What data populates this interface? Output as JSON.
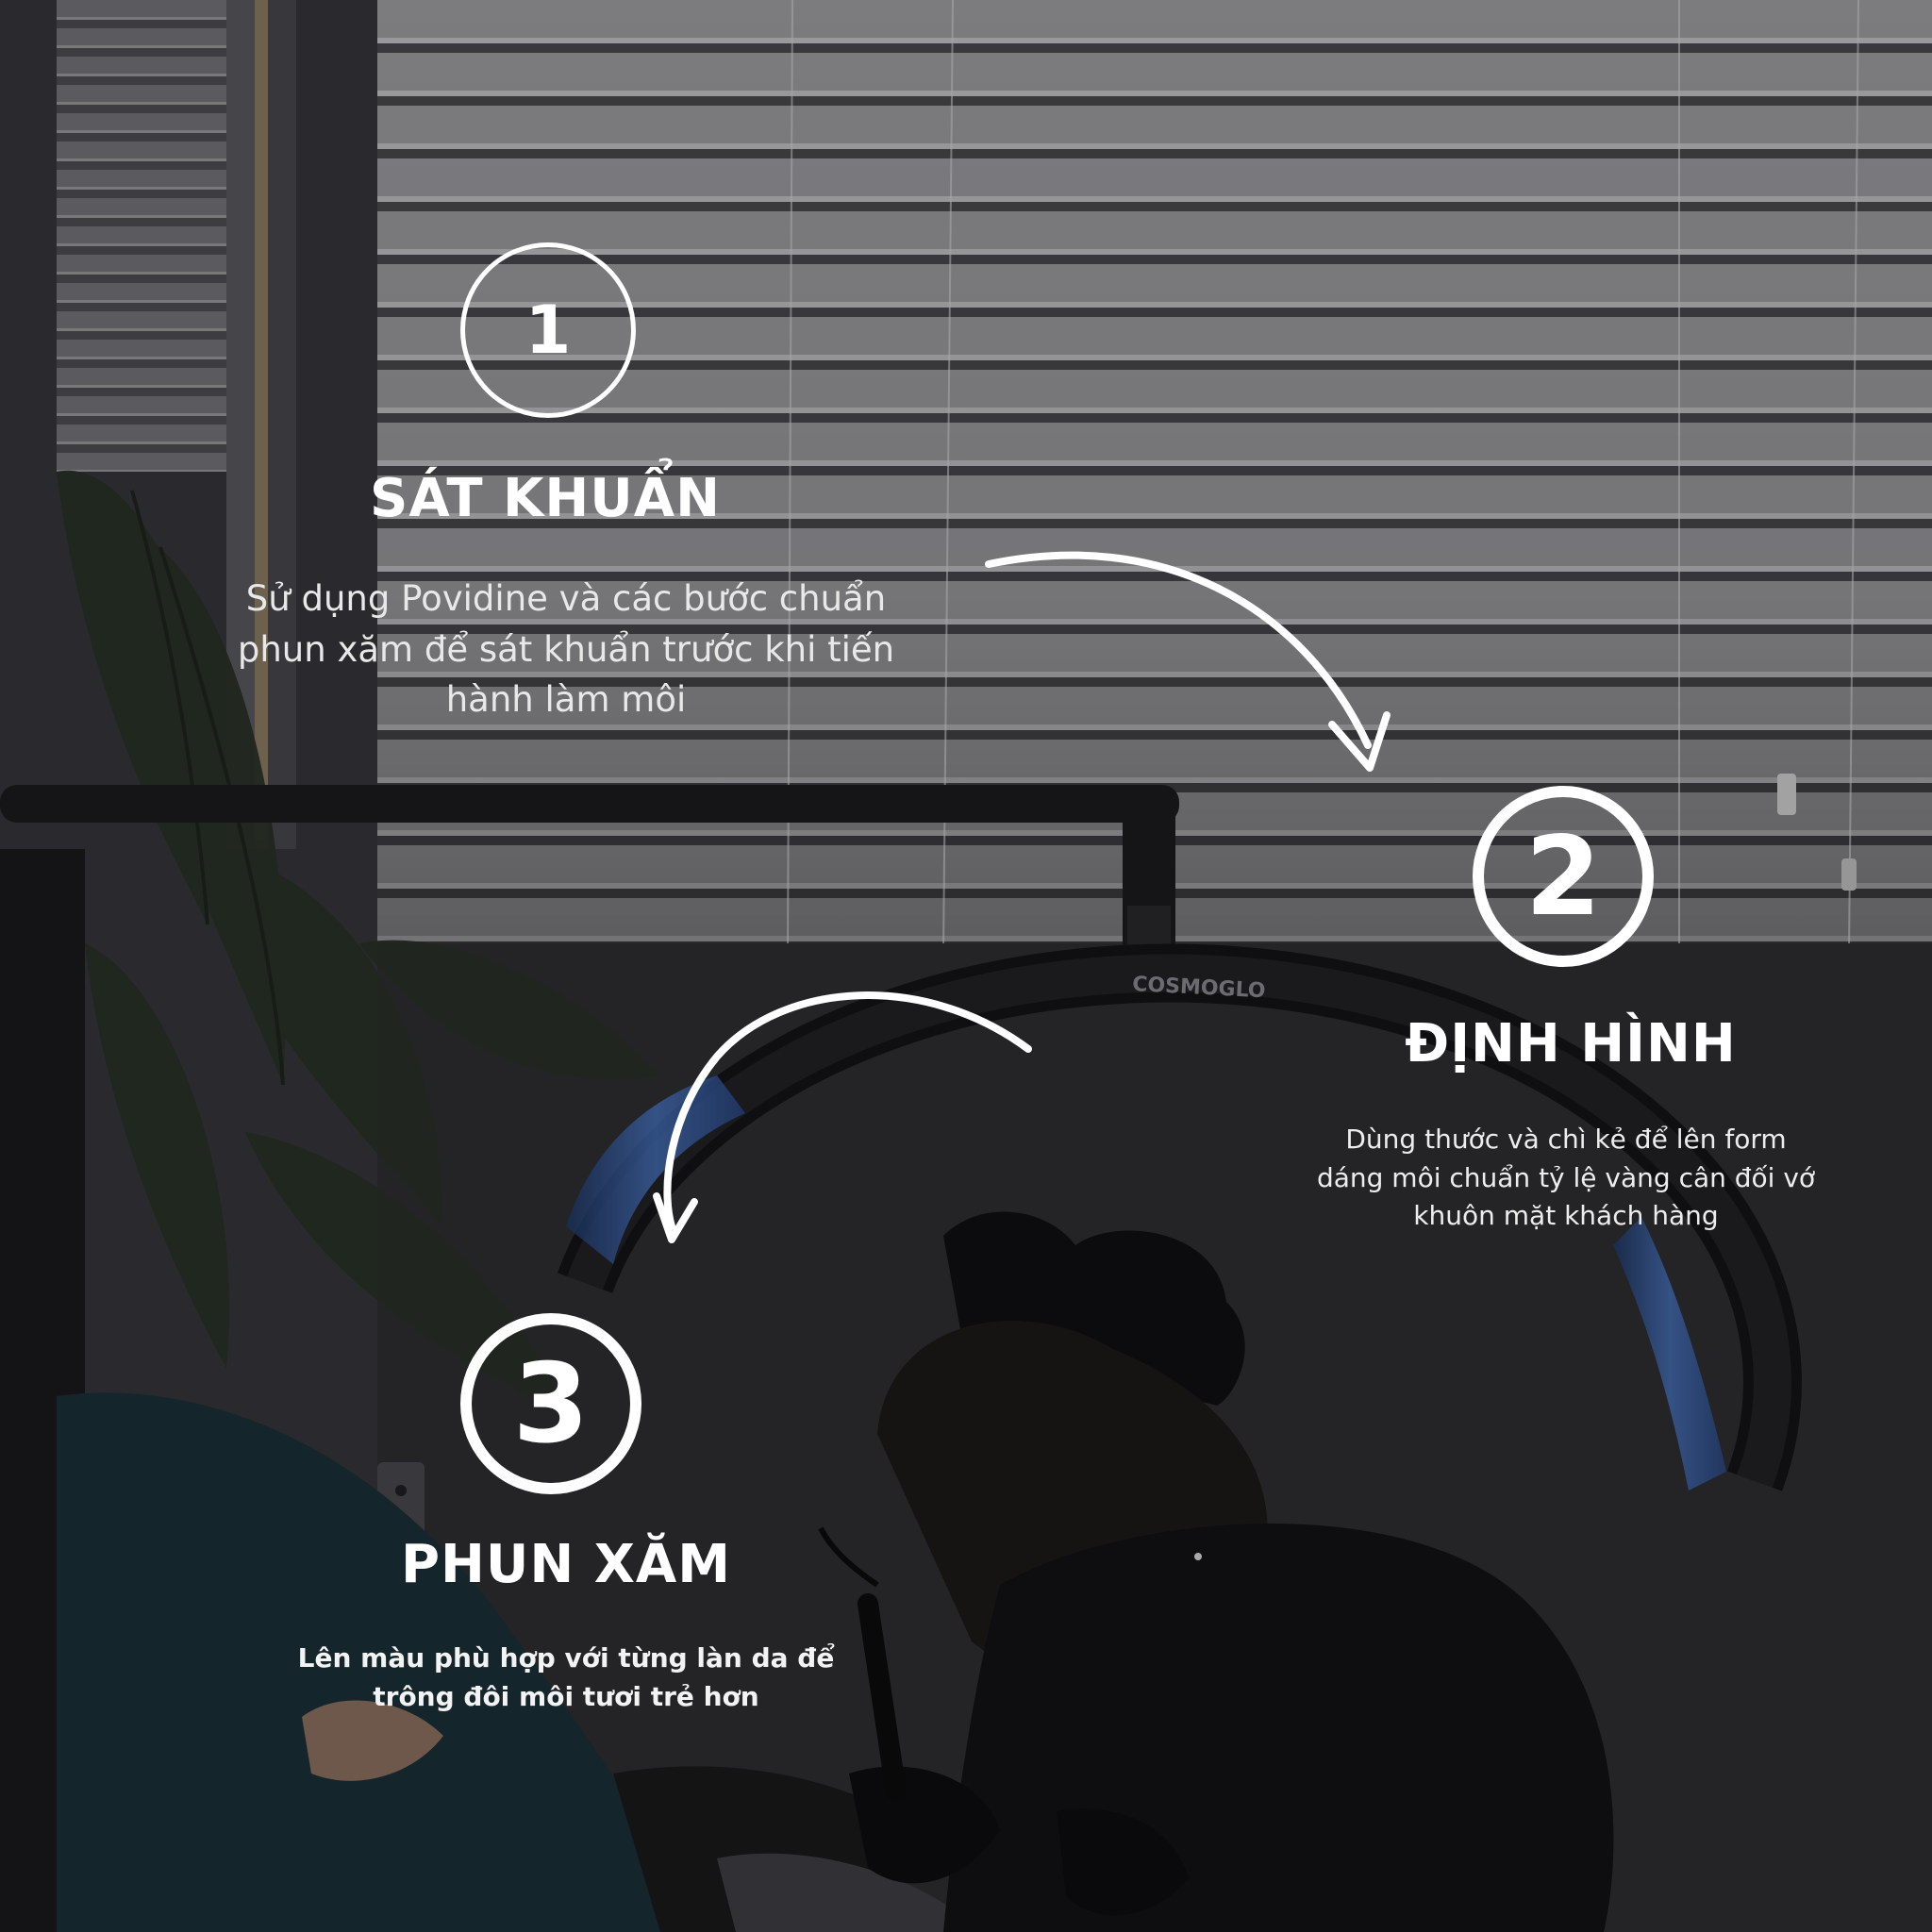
{
  "steps": [
    {
      "number": "1",
      "title": "SÁT KHUẨN",
      "description": [
        "Sử dụng Povidine và các bước chuẩn",
        "phun xăm để sát khuẩn trước khi tiến",
        "hành làm môi"
      ]
    },
    {
      "number": "2",
      "title": "ĐỊNH HÌNH",
      "description": [
        "Dùng thước và chì kẻ để lên form",
        "dáng môi chuẩn tỷ lệ vàng cân đối vớ",
        "khuôn mặt khách hàng"
      ]
    },
    {
      "number": "3",
      "title": "PHUN XĂM",
      "description": [
        "Lên màu phù hợp với từng làn da để",
        "trông đôi môi tươi trẻ hơn"
      ]
    }
  ],
  "photo": {
    "lamp_brand": "COSMOGLO"
  },
  "colors": {
    "text": "#ffffff",
    "blinds": "#a9a9ad",
    "wall": "#35353a",
    "accent_blue": "#4a78c8"
  }
}
